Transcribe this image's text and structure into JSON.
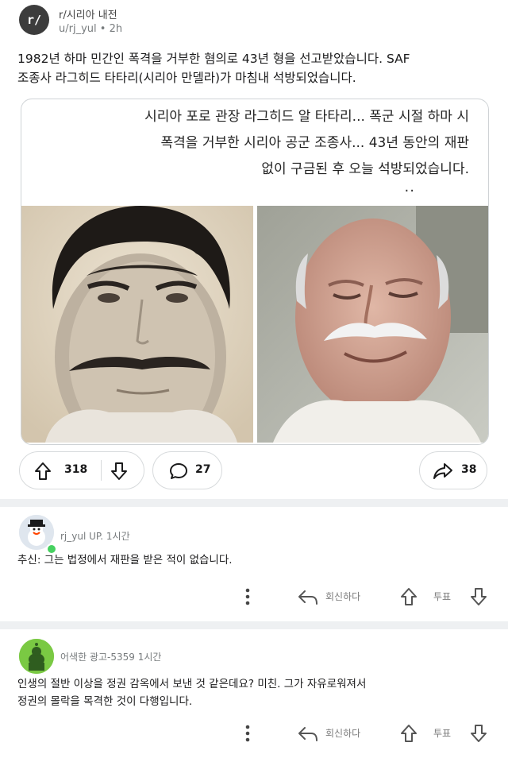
{
  "header": {
    "subreddit_icon": "r/",
    "subreddit": "r/시리아 내전",
    "author": "u/rj_yul",
    "separator": " • ",
    "age": "2h"
  },
  "post": {
    "title_line1": "1982년 하마 민간인 폭격을 거부한 혐의로 43년 형을 선고받았습니다. SAF",
    "title_line2": "조종사 라그히드 타타리(시리아 만델라)가 마침내 석방되었습니다.",
    "card_line1": "시리아 포로 관장 라그히드 알 타타리... 폭군 시절 하마 시",
    "card_line2": "폭격을 거부한 시리아 공군 조종사... 43년 동안의 재판",
    "card_line3": "없이 구금된 후 오늘 석방되었습니다.",
    "card_dots": "..",
    "upvotes": "318",
    "comments": "27",
    "shares": "38"
  },
  "comments": [
    {
      "author_line": "rj_yul UP. 1시간",
      "body": "추신: 그는 법정에서 재판을 받은 적이 없습니다.",
      "reply_label": "회신하다",
      "vote_label": "투표"
    },
    {
      "author_line": "어색한 광고-5359 1시간",
      "body_line1": "인생의 절반 이상을 정권 감옥에서 보낸 것 같은데요? 미친. 그가 자유로워져서",
      "body_line2": "정권의 몰락을 목격한 것이 다행입니다.",
      "reply_label": "회신하다",
      "vote_label": "투표"
    }
  ],
  "colors": {
    "divider": "#eef0f2",
    "online": "#46d160",
    "avatar_green": "#7ac943"
  },
  "icons": [
    "upvote-icon",
    "downvote-icon",
    "comment-icon",
    "share-icon",
    "more-icon",
    "reply-icon"
  ]
}
